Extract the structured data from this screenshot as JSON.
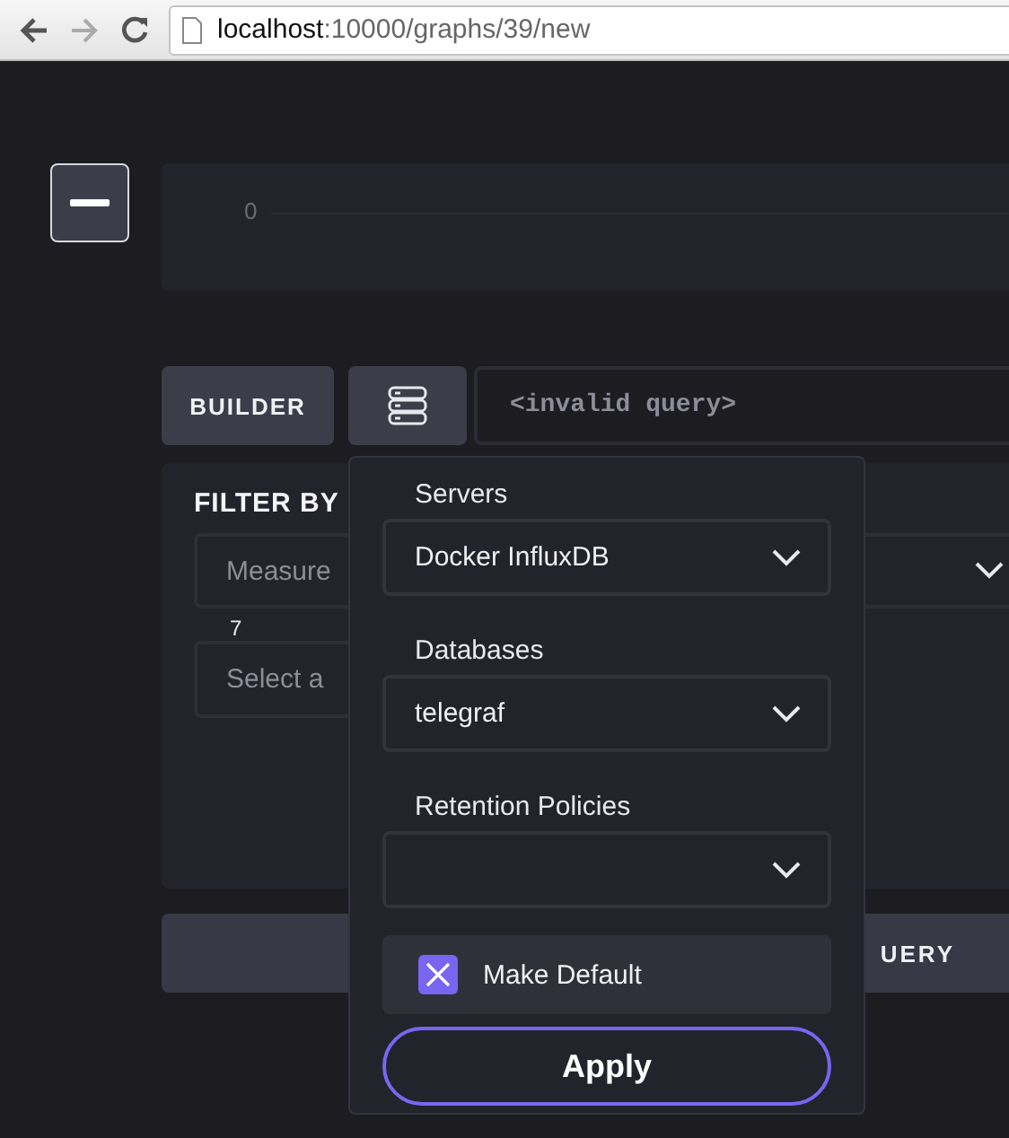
{
  "browser": {
    "url_host": "localhost",
    "url_path": ":10000/graphs/39/new"
  },
  "graph": {
    "y_tick": "0"
  },
  "query_bar": {
    "mode_button": "BUILDER",
    "query": "<invalid query>"
  },
  "filter": {
    "title": "FILTER BY",
    "measurement_placeholder": "Measure",
    "count": "7",
    "tag_placeholder": "Select a",
    "submit_label": "UERY"
  },
  "source_menu": {
    "fields": [
      {
        "label": "Servers",
        "value": "Docker InfluxDB"
      },
      {
        "label": "Databases",
        "value": "telegraf"
      },
      {
        "label": "Retention Policies"
      }
    ],
    "make_default": {
      "label": "Make Default",
      "checked": true
    },
    "apply": "Apply"
  }
}
